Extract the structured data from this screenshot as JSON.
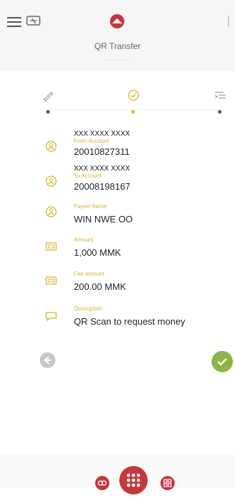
{
  "header": {
    "title": "QR Transfer",
    "subtitle_dots": "..........."
  },
  "steps": [
    {
      "icon": "pencil-icon",
      "active": false
    },
    {
      "icon": "check-circle-icon",
      "active": true
    },
    {
      "icon": "list-arrow-icon",
      "active": false
    }
  ],
  "fields": {
    "from_account": {
      "mask": "XXX XXXX XXXX",
      "label": "From Account",
      "value": "20010827311",
      "icon": "account-icon"
    },
    "to_account": {
      "mask": "XXX XXXX XXXX",
      "label": "To Account",
      "value": "20008198167",
      "icon": "account-icon"
    },
    "payee_name": {
      "label": "Payee Name",
      "value": "WIN NWE OO",
      "icon": "user-icon"
    },
    "amount": {
      "label": "Amount",
      "value": "1,000 MMK",
      "icon": "money-icon"
    },
    "fee_amount": {
      "label": "Fee amount",
      "value": "200.00 MMK",
      "icon": "money-icon"
    },
    "description": {
      "label": "Description",
      "value": "QR Scan to request money",
      "icon": "chat-icon"
    }
  },
  "colors": {
    "accent_gold": "#d6b52b",
    "brand_red": "#c9353c",
    "confirm_green": "#8db544",
    "back_gray": "#c7c7c7"
  }
}
